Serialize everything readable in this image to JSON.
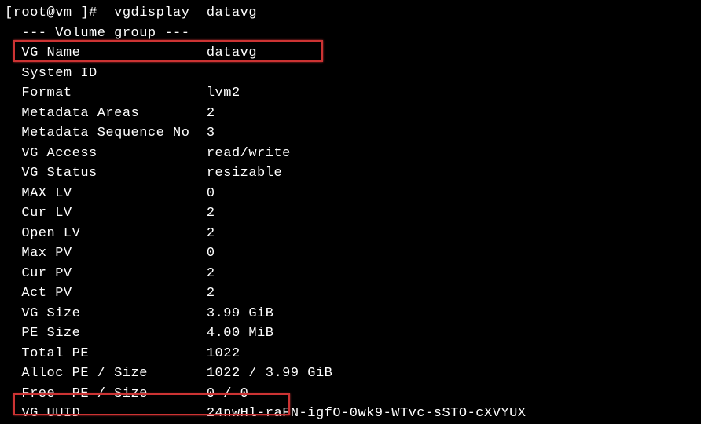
{
  "prompt": {
    "user_host": "[root@vm ]#",
    "command": "vgdisplay  datavg"
  },
  "header": "  --- Volume group ---",
  "rows": [
    {
      "label": "  VG Name              ",
      "value": "datavg"
    },
    {
      "label": "  System ID            ",
      "value": ""
    },
    {
      "label": "  Format               ",
      "value": "lvm2"
    },
    {
      "label": "  Metadata Areas       ",
      "value": "2"
    },
    {
      "label": "  Metadata Sequence No ",
      "value": "3"
    },
    {
      "label": "  VG Access            ",
      "value": "read/write"
    },
    {
      "label": "  VG Status            ",
      "value": "resizable"
    },
    {
      "label": "  MAX LV               ",
      "value": "0"
    },
    {
      "label": "  Cur LV               ",
      "value": "2"
    },
    {
      "label": "  Open LV              ",
      "value": "2"
    },
    {
      "label": "  Max PV               ",
      "value": "0"
    },
    {
      "label": "  Cur PV               ",
      "value": "2"
    },
    {
      "label": "  Act PV               ",
      "value": "2"
    },
    {
      "label": "  VG Size              ",
      "value": "3.99 GiB"
    },
    {
      "label": "  PE Size              ",
      "value": "4.00 MiB"
    },
    {
      "label": "  Total PE             ",
      "value": "1022"
    },
    {
      "label": "  Alloc PE / Size      ",
      "value": "1022 / 3.99 GiB"
    },
    {
      "label": "  Free  PE / Size      ",
      "value": "0 / 0"
    },
    {
      "label": "  VG UUID              ",
      "value": "24nwHl-raFN-igfO-0wk9-WTvc-sSTO-cXVYUX"
    }
  ]
}
